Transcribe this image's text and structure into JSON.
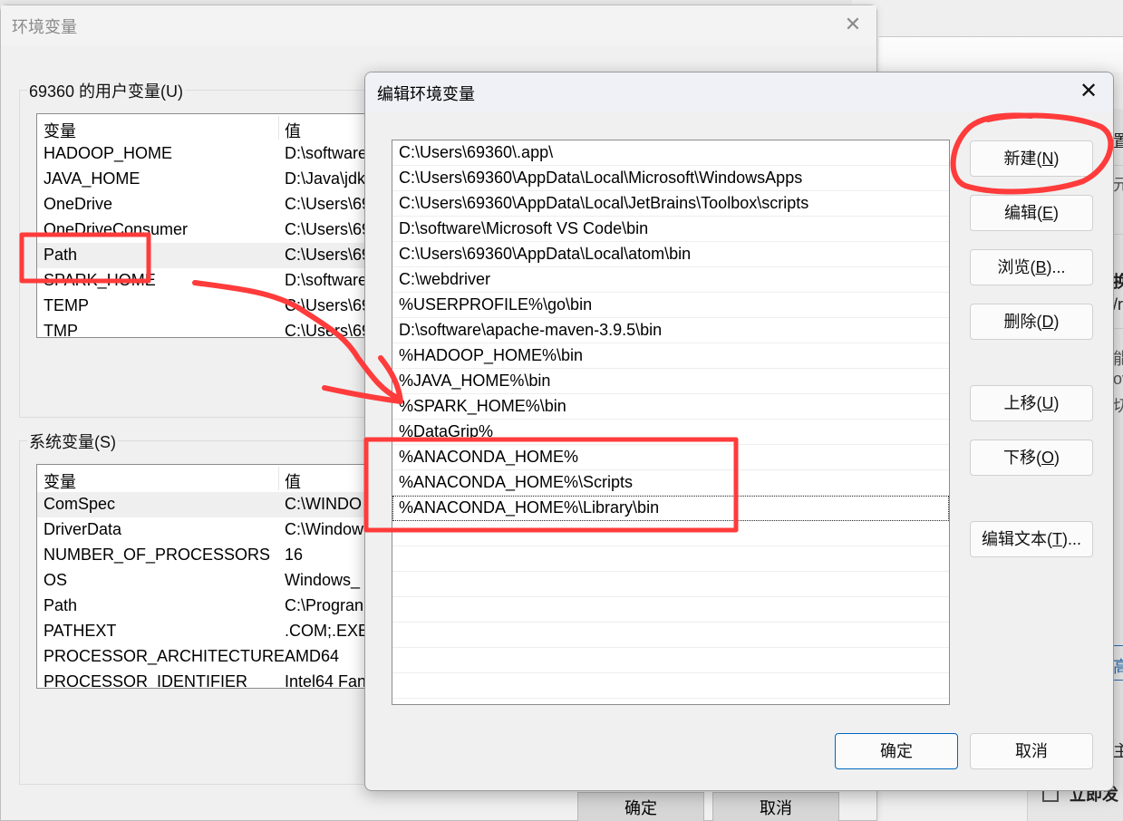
{
  "background_window": {
    "right_fragments": [
      "置",
      "元",
      "换",
      "/r",
      "能",
      "ov",
      "切",
      "高",
      "主"
    ],
    "bottom_fragment": "立即发"
  },
  "env_window": {
    "title": "环境变量",
    "close_icon": "close-icon",
    "user_vars": {
      "label": "69360 的用户变量(U)",
      "columns": [
        "变量",
        "值"
      ],
      "rows": [
        {
          "name": "HADOOP_HOME",
          "value": "D:\\software"
        },
        {
          "name": "JAVA_HOME",
          "value": "D:\\Java\\jdk"
        },
        {
          "name": "OneDrive",
          "value": "C:\\Users\\69"
        },
        {
          "name": "OneDriveConsumer",
          "value": "C:\\Users\\69"
        },
        {
          "name": "Path",
          "value": "C:\\Users\\69",
          "selected": true
        },
        {
          "name": "SPARK_HOME",
          "value": "D:\\software"
        },
        {
          "name": "TEMP",
          "value": "C:\\Users\\69"
        },
        {
          "name": "TMP",
          "value": "C:\\Users\\69"
        }
      ]
    },
    "system_vars": {
      "label": "系统变量(S)",
      "columns": [
        "变量",
        "值"
      ],
      "rows": [
        {
          "name": "ComSpec",
          "value": "C:\\WINDO",
          "selected": true
        },
        {
          "name": "DriverData",
          "value": "C:\\Window"
        },
        {
          "name": "NUMBER_OF_PROCESSORS",
          "value": "16"
        },
        {
          "name": "OS",
          "value": "Windows_"
        },
        {
          "name": "Path",
          "value": "C:\\Progran"
        },
        {
          "name": "PATHEXT",
          "value": ".COM;.EXE"
        },
        {
          "name": "PROCESSOR_ARCHITECTURE",
          "value": "AMD64"
        },
        {
          "name": "PROCESSOR_IDENTIFIER",
          "value": "Intel64 Fan"
        }
      ]
    },
    "ok_label": "确定",
    "cancel_label": "取消"
  },
  "edit_dialog": {
    "title": "编辑环境变量",
    "close_icon": "close-icon",
    "paths": [
      "C:\\Users\\69360\\.app\\",
      "C:\\Users\\69360\\AppData\\Local\\Microsoft\\WindowsApps",
      "C:\\Users\\69360\\AppData\\Local\\JetBrains\\Toolbox\\scripts",
      "D:\\software\\Microsoft VS Code\\bin",
      "C:\\Users\\69360\\AppData\\Local\\atom\\bin",
      "C:\\webdriver",
      "%USERPROFILE%\\go\\bin",
      "D:\\software\\apache-maven-3.9.5\\bin",
      "%HADOOP_HOME%\\bin",
      "%JAVA_HOME%\\bin",
      "%SPARK_HOME%\\bin",
      "%DataGrip%",
      "%ANACONDA_HOME%",
      "%ANACONDA_HOME%\\Scripts",
      "%ANACONDA_HOME%\\Library\\bin",
      "",
      "",
      "",
      "",
      "",
      "",
      "",
      ""
    ],
    "focused_index": 14,
    "buttons": {
      "new": {
        "text": "新建(",
        "key": "N",
        "tail": ")"
      },
      "edit": {
        "text": "编辑(",
        "key": "E",
        "tail": ")"
      },
      "browse": {
        "text": "浏览(",
        "key": "B",
        "tail": ")..."
      },
      "delete": {
        "text": "删除(",
        "key": "D",
        "tail": ")"
      },
      "move_up": {
        "text": "上移(",
        "key": "U",
        "tail": ")"
      },
      "move_down": {
        "text": "下移(",
        "key": "O",
        "tail": ")"
      },
      "edit_text": {
        "text": "编辑文本(",
        "key": "T",
        "tail": ")..."
      }
    },
    "ok_label": "确定",
    "cancel_label": "取消"
  },
  "annotations": {
    "color": "#ff3b3b",
    "items": [
      "box-around-user-path",
      "arrow-to-edit-dialog",
      "box-around-anaconda-paths",
      "circle-around-new-button"
    ]
  }
}
